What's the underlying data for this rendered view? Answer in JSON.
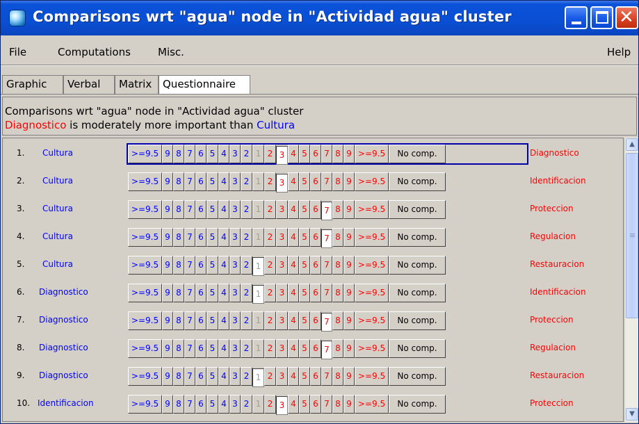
{
  "window": {
    "title": "Comparisons wrt \"agua\" node in \"Actividad agua\" cluster"
  },
  "menu": {
    "file": "File",
    "computations": "Computations",
    "misc": "Misc.",
    "help": "Help"
  },
  "tabs": [
    "Graphic",
    "Verbal",
    "Matrix",
    "Questionnaire"
  ],
  "active_tab": "Questionnaire",
  "description": {
    "line1": "Comparisons wrt \"agua\" node in \"Actividad agua\" cluster",
    "line2_left": "Diagnostico",
    "line2_mid": " is moderately more important than ",
    "line2_right": "Cultura"
  },
  "scale": {
    "left": [
      ">=9.5",
      "9",
      "8",
      "7",
      "6",
      "5",
      "4",
      "3",
      "2"
    ],
    "middle": "1",
    "right": [
      "2",
      "3",
      "4",
      "5",
      "6",
      "7",
      "8",
      "9",
      ">=9.5"
    ],
    "no_comp": "No comp."
  },
  "colors": {
    "left": "#0000ff",
    "right": "#ff0000",
    "middle": "#a0a0a0"
  },
  "rows": [
    {
      "num": "1.",
      "left": "Cultura",
      "right": "Diagnostico",
      "selected": "R3",
      "focused": true
    },
    {
      "num": "2.",
      "left": "Cultura",
      "right": "Identificacion",
      "selected": "R3",
      "focused": false
    },
    {
      "num": "3.",
      "left": "Cultura",
      "right": "Proteccion",
      "selected": "R7",
      "focused": false
    },
    {
      "num": "4.",
      "left": "Cultura",
      "right": "Regulacion",
      "selected": "R7",
      "focused": false
    },
    {
      "num": "5.",
      "left": "Cultura",
      "right": "Restauracion",
      "selected": "M1",
      "focused": false
    },
    {
      "num": "6.",
      "left": "Diagnostico",
      "right": "Identificacion",
      "selected": "M1",
      "focused": false
    },
    {
      "num": "7.",
      "left": "Diagnostico",
      "right": "Proteccion",
      "selected": "R7",
      "focused": false
    },
    {
      "num": "8.",
      "left": "Diagnostico",
      "right": "Regulacion",
      "selected": "R7",
      "focused": false
    },
    {
      "num": "9.",
      "left": "Diagnostico",
      "right": "Restauracion",
      "selected": "M1",
      "focused": false
    },
    {
      "num": "10.",
      "left": "Identificacion",
      "right": "Proteccion",
      "selected": "R3",
      "focused": false
    }
  ],
  "icons": {
    "app": "app-icon",
    "minimize": "minimize-icon",
    "maximize": "maximize-icon",
    "close": "close-icon",
    "scroll_up": "scroll-up-icon",
    "scroll_down": "scroll-down-icon"
  }
}
